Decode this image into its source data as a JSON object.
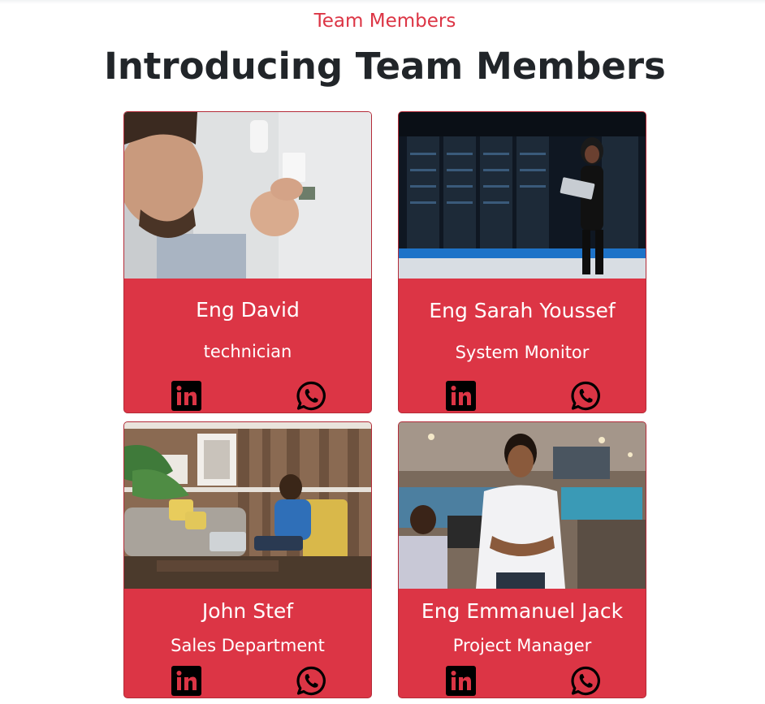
{
  "section": {
    "eyebrow": "Team Members",
    "title": "Introducing Team Members"
  },
  "colors": {
    "accent": "#dc3545",
    "heading": "#212529",
    "card_text": "#ffffff",
    "icon": "#000000"
  },
  "team": [
    {
      "name": "Eng David",
      "role": "technician",
      "photo": "photo-technician-installing-sensor",
      "icons": [
        "linkedin-icon",
        "whatsapp-icon"
      ]
    },
    {
      "name": "Eng Sarah Youssef",
      "role": "System Monitor",
      "photo": "photo-woman-in-server-room",
      "icons": [
        "linkedin-icon",
        "whatsapp-icon"
      ]
    },
    {
      "name": "John Stef",
      "role": "Sales Department",
      "photo": "photo-man-in-lounge-with-laptop",
      "icons": [
        "linkedin-icon",
        "whatsapp-icon"
      ]
    },
    {
      "name": "Eng Emmanuel Jack",
      "role": "Project Manager",
      "photo": "photo-man-in-office",
      "icons": [
        "linkedin-icon",
        "whatsapp-icon"
      ]
    }
  ]
}
